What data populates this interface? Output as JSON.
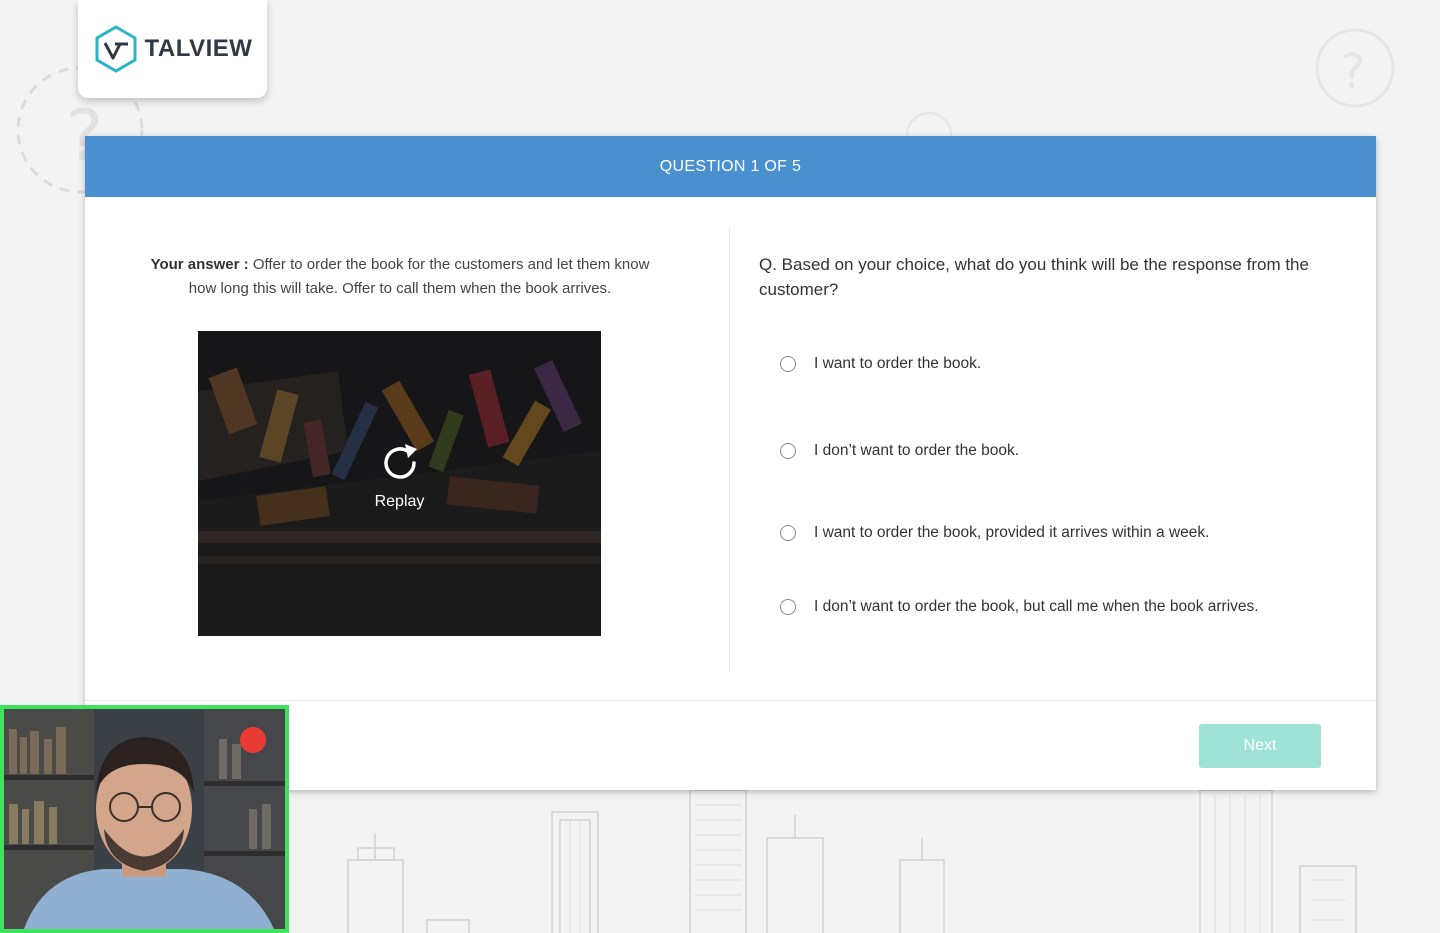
{
  "brand": {
    "name": "TALVIEW"
  },
  "header": {
    "progress": "QUESTION 1 OF 5"
  },
  "answer": {
    "label": "Your answer :",
    "text": "Offer to order the book for the customers and let them know how long this will take. Offer to call them when the book arrives."
  },
  "video": {
    "replay_label": "Replay"
  },
  "question": {
    "text": "Q. Based on your choice, what do you think will be the response from the customer?",
    "options": [
      {
        "label": "I want to order the book.",
        "selected": false
      },
      {
        "label": "I don’t want to order the book.",
        "selected": false
      },
      {
        "label": "I want to order the book, provided it arrives within a week.",
        "selected": false
      },
      {
        "label": "I don’t want to order the book, but call me when the book arrives.",
        "selected": false
      }
    ]
  },
  "footer": {
    "next_label": "Next",
    "next_enabled": false
  },
  "webcam": {
    "recording": true,
    "border_color": "#3fe35b",
    "rec_color": "#e93b34"
  },
  "colors": {
    "header": "#4a90cf",
    "next_button": "#9fe3d7",
    "logo_accent": "#2bb5c4"
  },
  "icons": {
    "logo": "talview-hexagon-logo",
    "replay": "replay-icon",
    "help": "question-mark-icon"
  }
}
